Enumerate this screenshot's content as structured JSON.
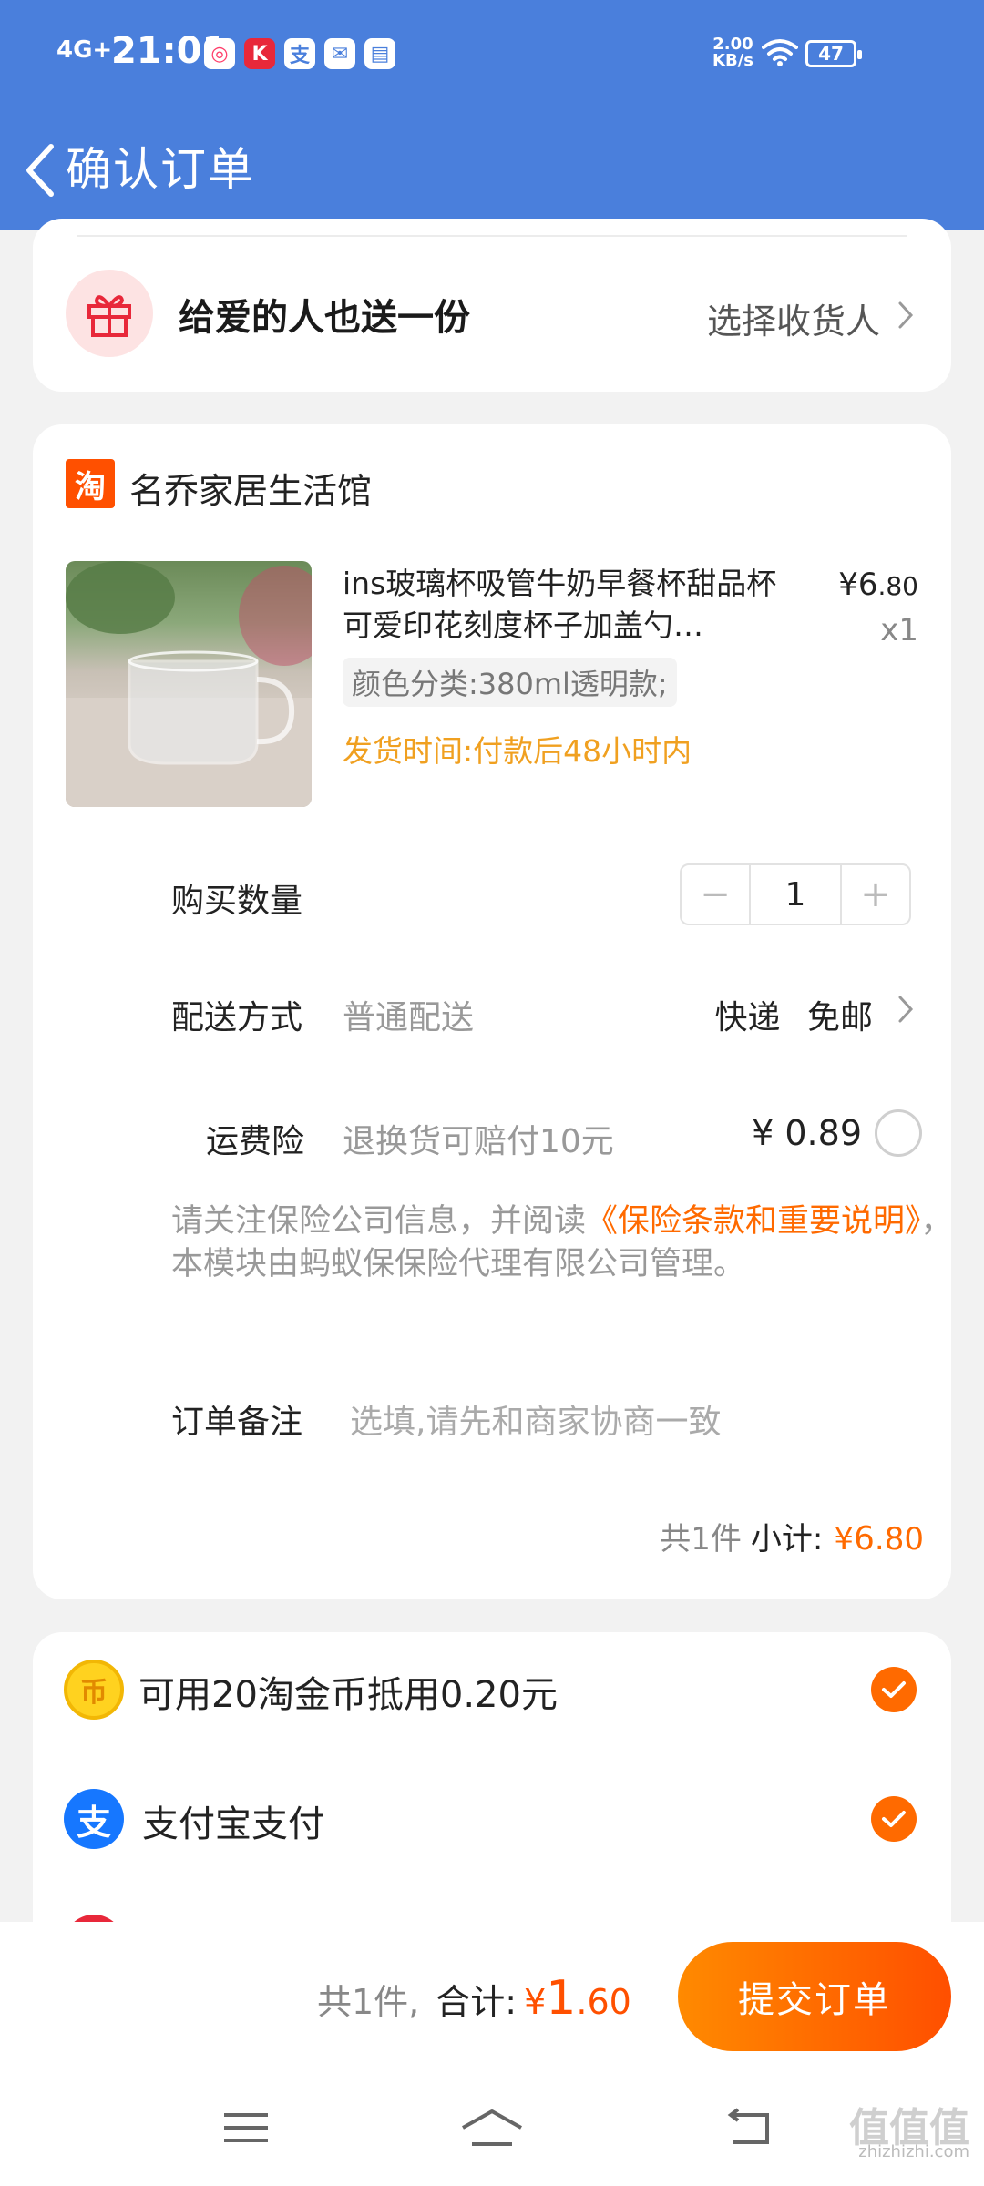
{
  "status_bar": {
    "network": "4G+",
    "time": "21:01",
    "speed_value": "2.00",
    "speed_unit": "KB/s",
    "battery": "47",
    "apps": [
      "app-icon-1",
      "app-icon-2",
      "alipay-icon",
      "message-icon",
      "mail-icon"
    ],
    "app_glyph_2": "K",
    "app_glyph_3": "支"
  },
  "header": {
    "title": "确认订单",
    "bg_color": "#4a7fdc"
  },
  "gift": {
    "title": "给爱的人也送一份",
    "action": "选择收货人"
  },
  "shop": {
    "icon_glyph": "淘",
    "name": "名乔家居生活馆",
    "product": {
      "title": "ins玻璃杯吸管牛奶早餐杯甜品杯可爱印花刻度杯子加盖勺…",
      "price_symbol": "¥",
      "price_int": "6",
      "price_dec": ".80",
      "qty": "x1",
      "sku": "颜色分类:380ml透明款;",
      "ship_time": "发货时间:付款后48小时内"
    },
    "quantity": {
      "label": "购买数量",
      "minus": "−",
      "value": "1",
      "plus": "+"
    },
    "delivery": {
      "label": "配送方式",
      "sub": "普通配送",
      "value": "快递 免邮"
    },
    "insurance": {
      "label": "运费险",
      "sub": "退换货可赔付10元",
      "price": "¥ 0.89",
      "selected": false
    },
    "notice": {
      "before": "请关注保险公司信息，并阅读",
      "link": "《保险条款和重要说明》",
      "after": "，本模块由蚂蚁保保险代理有限公司管理。"
    },
    "remark": {
      "label": "订单备注",
      "placeholder": "选填,请先和商家协商一致"
    },
    "subtotal": {
      "count": "共1件",
      "label": "小计:",
      "symbol": "¥",
      "int": "6",
      "dec": ".80"
    }
  },
  "payment": {
    "coin_glyph": "币",
    "coin_text": "可用20淘金币抵用0.20元",
    "coin_checked": true,
    "alipay_glyph": "支",
    "alipay_text": "支付宝支付",
    "alipay_checked": true,
    "accent_color": "#ff6a00"
  },
  "footer": {
    "count": "共1件,",
    "total_label": "合计:",
    "symbol": "¥",
    "int": "1",
    "dec": ".60",
    "submit": "提交订单",
    "watermark": "zhizhizhi.com",
    "watermark_logo": "值值值"
  }
}
